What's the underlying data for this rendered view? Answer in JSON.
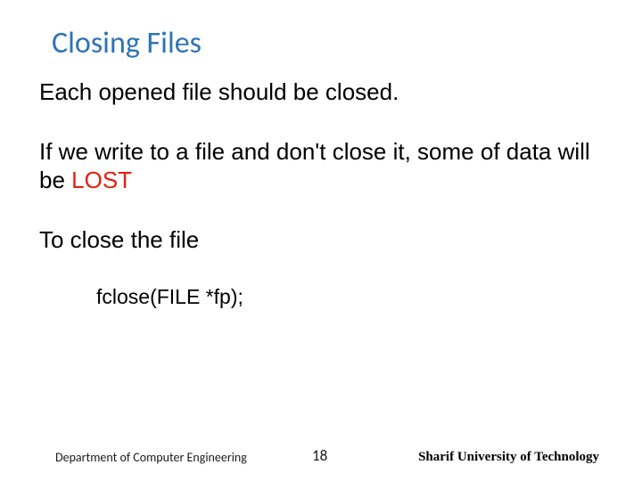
{
  "title": "Closing Files",
  "bullets": {
    "b1": "Each opened file should be closed.",
    "b2_pre": "If we write to a file and don't close it, some of data will be ",
    "b2_lost": "LOST",
    "b3": "To close the file"
  },
  "code": "fclose(FILE *fp);",
  "footer": {
    "dept": "Department of Computer Engineering",
    "page": "18",
    "univ": "Sharif University of Technology"
  }
}
